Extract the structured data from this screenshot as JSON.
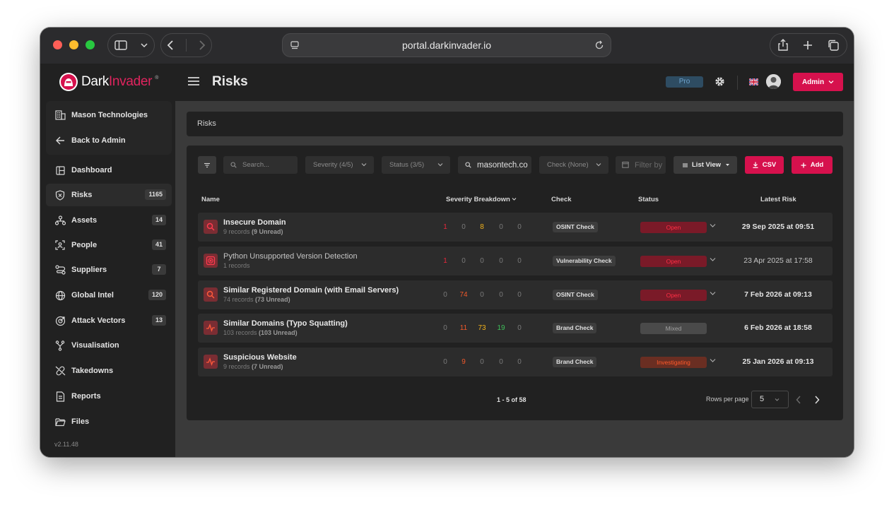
{
  "browser": {
    "url": "portal.darkinvader.io"
  },
  "header": {
    "logo_dark": "Dark",
    "logo_invader": "Invader",
    "title": "Risks",
    "plan_badge": "Pro",
    "admin_label": "Admin"
  },
  "sidebar": {
    "org_name": "Mason Technologies",
    "back_label": "Back to Admin",
    "items": [
      {
        "label": "Dashboard",
        "count": null
      },
      {
        "label": "Risks",
        "count": "1165"
      },
      {
        "label": "Assets",
        "count": "14"
      },
      {
        "label": "People",
        "count": "41"
      },
      {
        "label": "Suppliers",
        "count": "7"
      },
      {
        "label": "Global Intel",
        "count": "120"
      },
      {
        "label": "Attack Vectors",
        "count": "13"
      },
      {
        "label": "Visualisation",
        "count": null
      },
      {
        "label": "Takedowns",
        "count": null
      },
      {
        "label": "Reports",
        "count": null
      },
      {
        "label": "Files",
        "count": null
      }
    ],
    "version": "v2.11.48"
  },
  "breadcrumb": "Risks",
  "toolbar": {
    "search_placeholder": "Search...",
    "severity": "Severity (4/5)",
    "status": "Status (3/5)",
    "domain": "masontech.co",
    "check": "Check (None)",
    "filter_placeholder": "Filter by",
    "list_view": "List View",
    "csv": "CSV",
    "add": "Add"
  },
  "table": {
    "headers": {
      "name": "Name",
      "severity": "Severity Breakdown",
      "check": "Check",
      "status": "Status",
      "latest": "Latest Risk"
    },
    "rows": [
      {
        "name": "Insecure Domain",
        "records": "9 records",
        "unread": "(9 Unread)",
        "sev": [
          "1",
          "0",
          "8",
          "0",
          "0"
        ],
        "check": "OSINT Check",
        "status": "Open",
        "latest": "29 Sep 2025 at 09:51"
      },
      {
        "name": "Python Unsupported Version Detection",
        "records": "1 records",
        "unread": "",
        "sev": [
          "1",
          "0",
          "0",
          "0",
          "0"
        ],
        "check": "Vulnerability Check",
        "status": "Open",
        "latest": "23 Apr 2025 at 17:58"
      },
      {
        "name": "Similar Registered Domain (with Email Servers)",
        "records": "74 records",
        "unread": "(73 Unread)",
        "sev": [
          "0",
          "74",
          "0",
          "0",
          "0"
        ],
        "check": "OSINT Check",
        "status": "Open",
        "latest": "7 Feb 2026 at 09:13"
      },
      {
        "name": "Similar Domains (Typo Squatting)",
        "records": "103 records",
        "unread": "(103 Unread)",
        "sev": [
          "0",
          "11",
          "73",
          "19",
          "0"
        ],
        "check": "Brand Check",
        "status": "Mixed",
        "latest": "6 Feb 2026 at 18:58"
      },
      {
        "name": "Suspicious Website",
        "records": "9 records",
        "unread": "(7 Unread)",
        "sev": [
          "0",
          "9",
          "0",
          "0",
          "0"
        ],
        "check": "Brand Check",
        "status": "Investigating",
        "latest": "25 Jan 2026 at 09:13"
      }
    ]
  },
  "pagination": {
    "range": "1 - 5 of 58",
    "rows_label": "Rows per page",
    "rows_value": "5"
  },
  "colors": {
    "accent": "#d6114d",
    "critical": "#e8283b",
    "high": "#f0582a",
    "medium": "#f2b21b",
    "low": "#3fbf5a"
  }
}
